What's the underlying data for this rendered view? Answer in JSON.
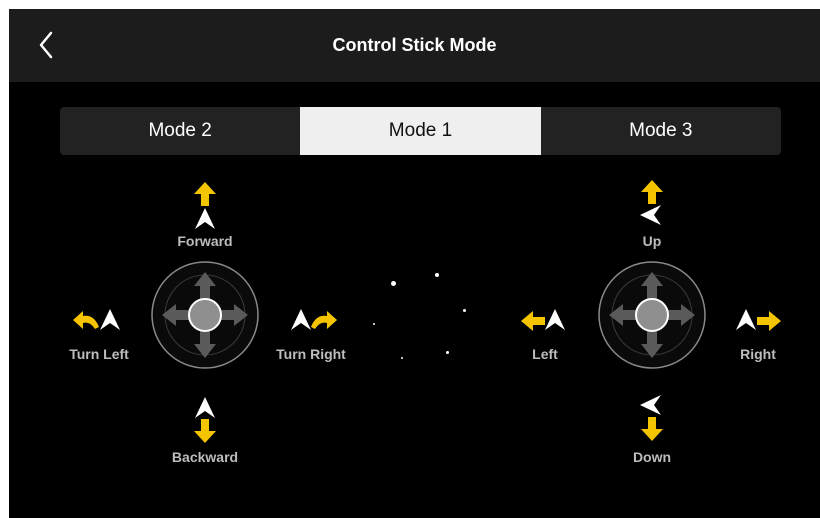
{
  "header": {
    "title": "Control Stick Mode"
  },
  "tabs": [
    {
      "label": "Mode 2",
      "active": false
    },
    {
      "label": "Mode 1",
      "active": true
    },
    {
      "label": "Mode 3",
      "active": false
    }
  ],
  "left_stick": {
    "up": "Forward",
    "down": "Backward",
    "left": "Turn Left",
    "right": "Turn Right"
  },
  "right_stick": {
    "up": "Up",
    "down": "Down",
    "left": "Left",
    "right": "Right"
  },
  "colors": {
    "accent": "#f5c400",
    "label": "#bdbdbd",
    "topbar": "#1c1c1c",
    "active_tab": "#efefef"
  },
  "icons": [
    "chevron-left-icon",
    "arrow-up-icon",
    "arrow-down-icon",
    "arrow-left-icon",
    "arrow-right-icon",
    "turn-left-icon",
    "turn-right-icon",
    "aircraft-icon",
    "joystick-icon"
  ]
}
